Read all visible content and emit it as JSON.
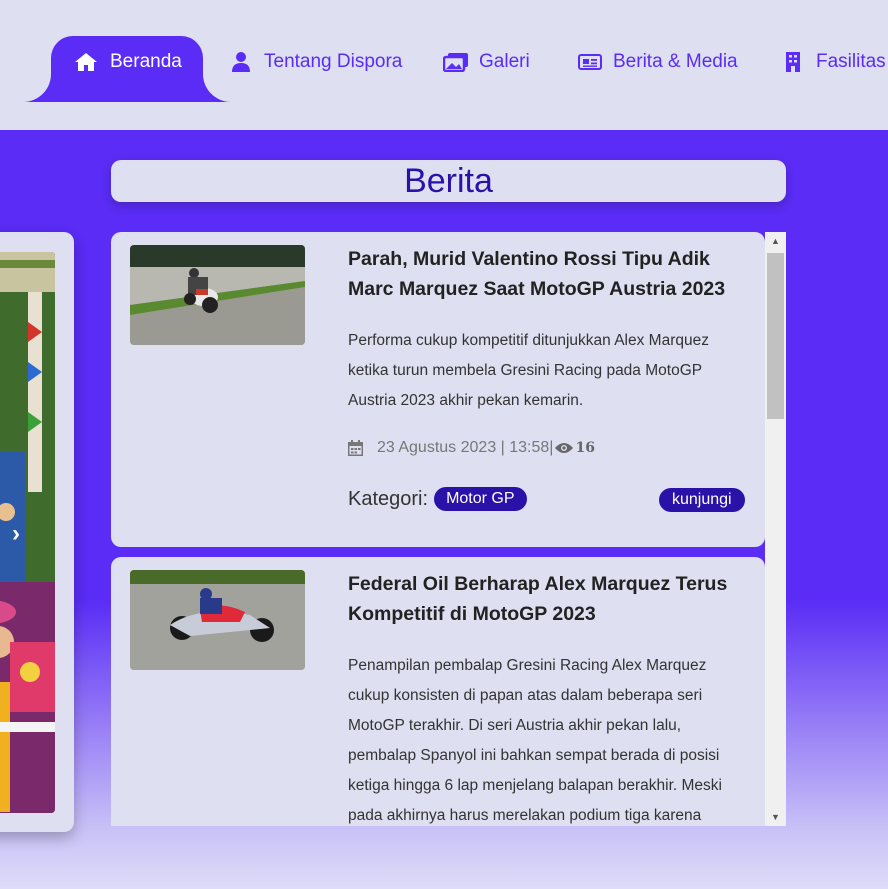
{
  "nav": {
    "items": [
      {
        "label": "Beranda",
        "icon": "home-icon",
        "active": true
      },
      {
        "label": "Tentang Dispora",
        "icon": "user-icon"
      },
      {
        "label": "Galeri",
        "icon": "images-icon"
      },
      {
        "label": "Berita & Media",
        "icon": "newspaper-icon"
      },
      {
        "label": "Fasilitas",
        "icon": "building-icon"
      }
    ]
  },
  "section": {
    "title": "Berita"
  },
  "news": [
    {
      "title": "Parah, Murid Valentino Rossi Tipu Adik Marc Marquez Saat MotoGP Austria 2023",
      "excerpt": "Performa cukup kompetitif ditunjukkan Alex Marquez ketika turun membela Gresini Racing pada MotoGP Austria 2023 akhir pekan kemarin.",
      "date": "23 Agustus 2023 | 13:58|",
      "views": "16",
      "category_label": "Kategori:",
      "category": "Motor GP",
      "visit_label": "kunjungi"
    },
    {
      "title": "Federal Oil Berharap Alex Marquez Terus Kompetitif di MotoGP 2023",
      "excerpt": "Penampilan pembalap Gresini Racing Alex Marquez cukup konsisten di papan atas dalam beberapa seri MotoGP terakhir. Di seri Austria akhir pekan lalu, pembalap Spanyol ini bahkan sempat berada di posisi ketiga hingga 6 lap menjelang balapan berakhir. Meski pada akhirnya harus merelakan podium tiga karena"
    }
  ],
  "colors": {
    "accent": "#5a2cf5",
    "dark_accent": "#2a12a8",
    "card_bg": "#dedff0"
  }
}
